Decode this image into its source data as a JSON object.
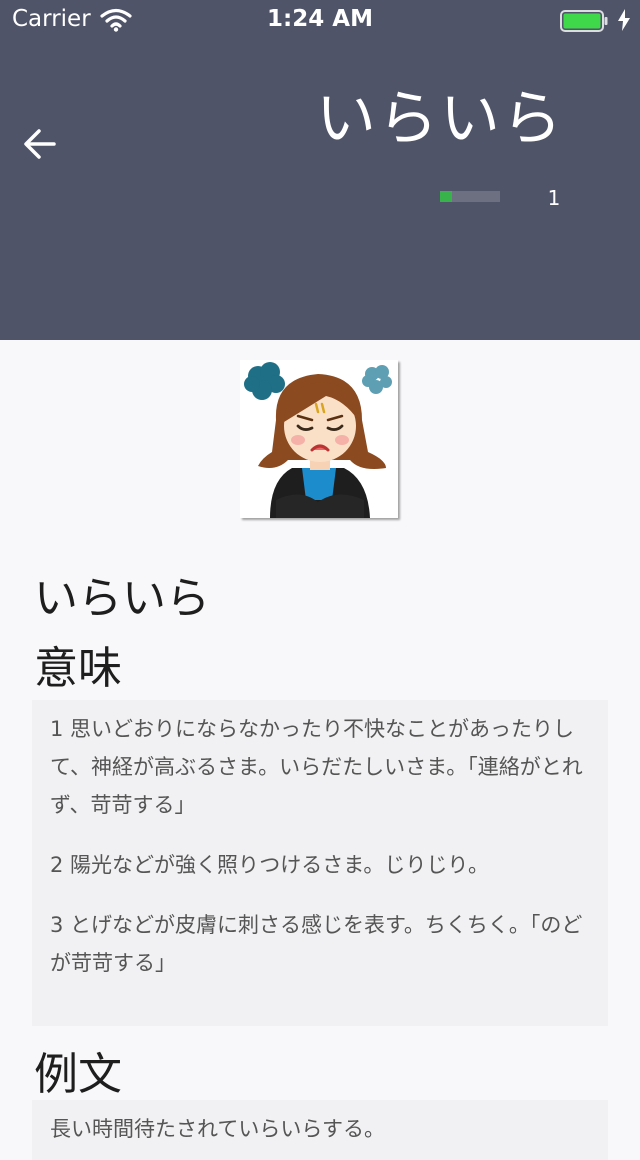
{
  "status_bar": {
    "carrier": "Carrier",
    "time": "1:24 AM",
    "battery_color": "#3fd84a"
  },
  "header": {
    "title": "いらいら",
    "progress_count": "1",
    "progress_fraction": 0.2,
    "background_color": "#4f5468",
    "back_icon": "arrow-left-icon"
  },
  "word": {
    "title": "いらいら",
    "illustration": "irritated-woman-illustration"
  },
  "meaning": {
    "heading": "意味",
    "items": [
      "1 思いどおりにならなかったり不快なことがあったりして、神経が高ぶるさま。いらだたしいさま。「連絡がとれず、苛苛する」",
      "2 陽光などが強く照りつけるさま。じりじり。",
      "3 とげなどが皮膚に刺さる感じを表す。ちくちく。「のどが苛苛する」"
    ]
  },
  "examples": {
    "heading": "例文",
    "items": [
      "長い時間待たされていらいらする。"
    ]
  }
}
